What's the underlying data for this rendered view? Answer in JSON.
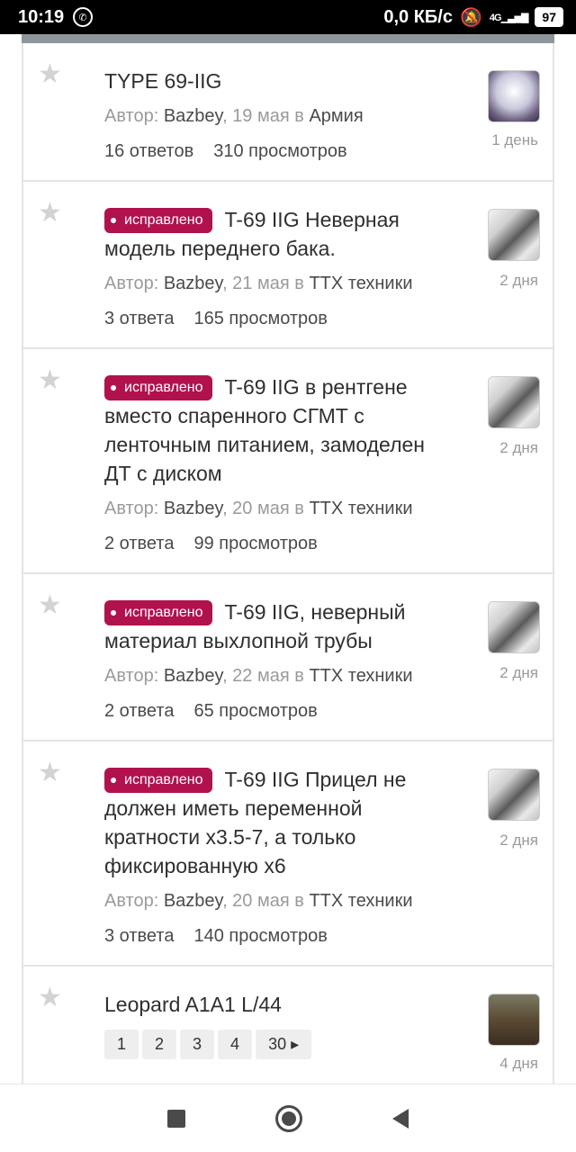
{
  "status_bar": {
    "time": "10:19",
    "whatsapp_icon": "whatsapp-icon",
    "speed": "0,0 КБ/с",
    "network": "4G",
    "battery": "97"
  },
  "topics": [
    {
      "title": "TYPE 69-IIG",
      "badge": "",
      "author_label": "Автор:",
      "author": "Bazbey",
      "date": ", 19 мая в",
      "forum": "Армия",
      "answers": "16 ответов",
      "views": "310 просмотров",
      "when": "1 день",
      "avatar": "av-a"
    },
    {
      "title": "T-69 IIG Неверная модель переднего бака.",
      "badge": "исправлено",
      "author_label": "Автор:",
      "author": "Bazbey",
      "date": ", 21 мая в",
      "forum": "ТТХ техники",
      "answers": "3 ответа",
      "views": "165 просмотров",
      "when": "2 дня",
      "avatar": "av-b"
    },
    {
      "title": "T-69 IIG в рентгене вместо спаренного СГМТ с ленточным питанием, замоделен ДТ с диском",
      "badge": "исправлено",
      "author_label": "Автор:",
      "author": "Bazbey",
      "date": ", 20 мая в",
      "forum": "ТТХ техники",
      "answers": "2 ответа",
      "views": "99 просмотров",
      "when": "2 дня",
      "avatar": "av-b"
    },
    {
      "title": "T-69 IIG, неверный материал выхлопной трубы",
      "badge": "исправлено",
      "author_label": "Автор:",
      "author": "Bazbey",
      "date": ", 22 мая в",
      "forum": "ТТХ техники",
      "answers": "2 ответа",
      "views": "65 просмотров",
      "when": "2 дня",
      "avatar": "av-b"
    },
    {
      "title": "T-69 IIG Прицел не должен иметь переменной кратности x3.5-7, а только фиксированную x6",
      "badge": "исправлено",
      "author_label": "Автор:",
      "author": "Bazbey",
      "date": ", 20 мая в",
      "forum": "ТТХ техники",
      "answers": "3 ответа",
      "views": "140 просмотров",
      "when": "2 дня",
      "avatar": "av-b"
    }
  ],
  "last_topic": {
    "title": "Leopard A1A1 L/44",
    "pages": [
      "1",
      "2",
      "3",
      "4",
      "30 ▸"
    ],
    "when": "4 дня"
  },
  "nav": {
    "recents_icon": "square-icon",
    "home_icon": "circle-icon",
    "back_icon": "back-triangle-icon"
  }
}
